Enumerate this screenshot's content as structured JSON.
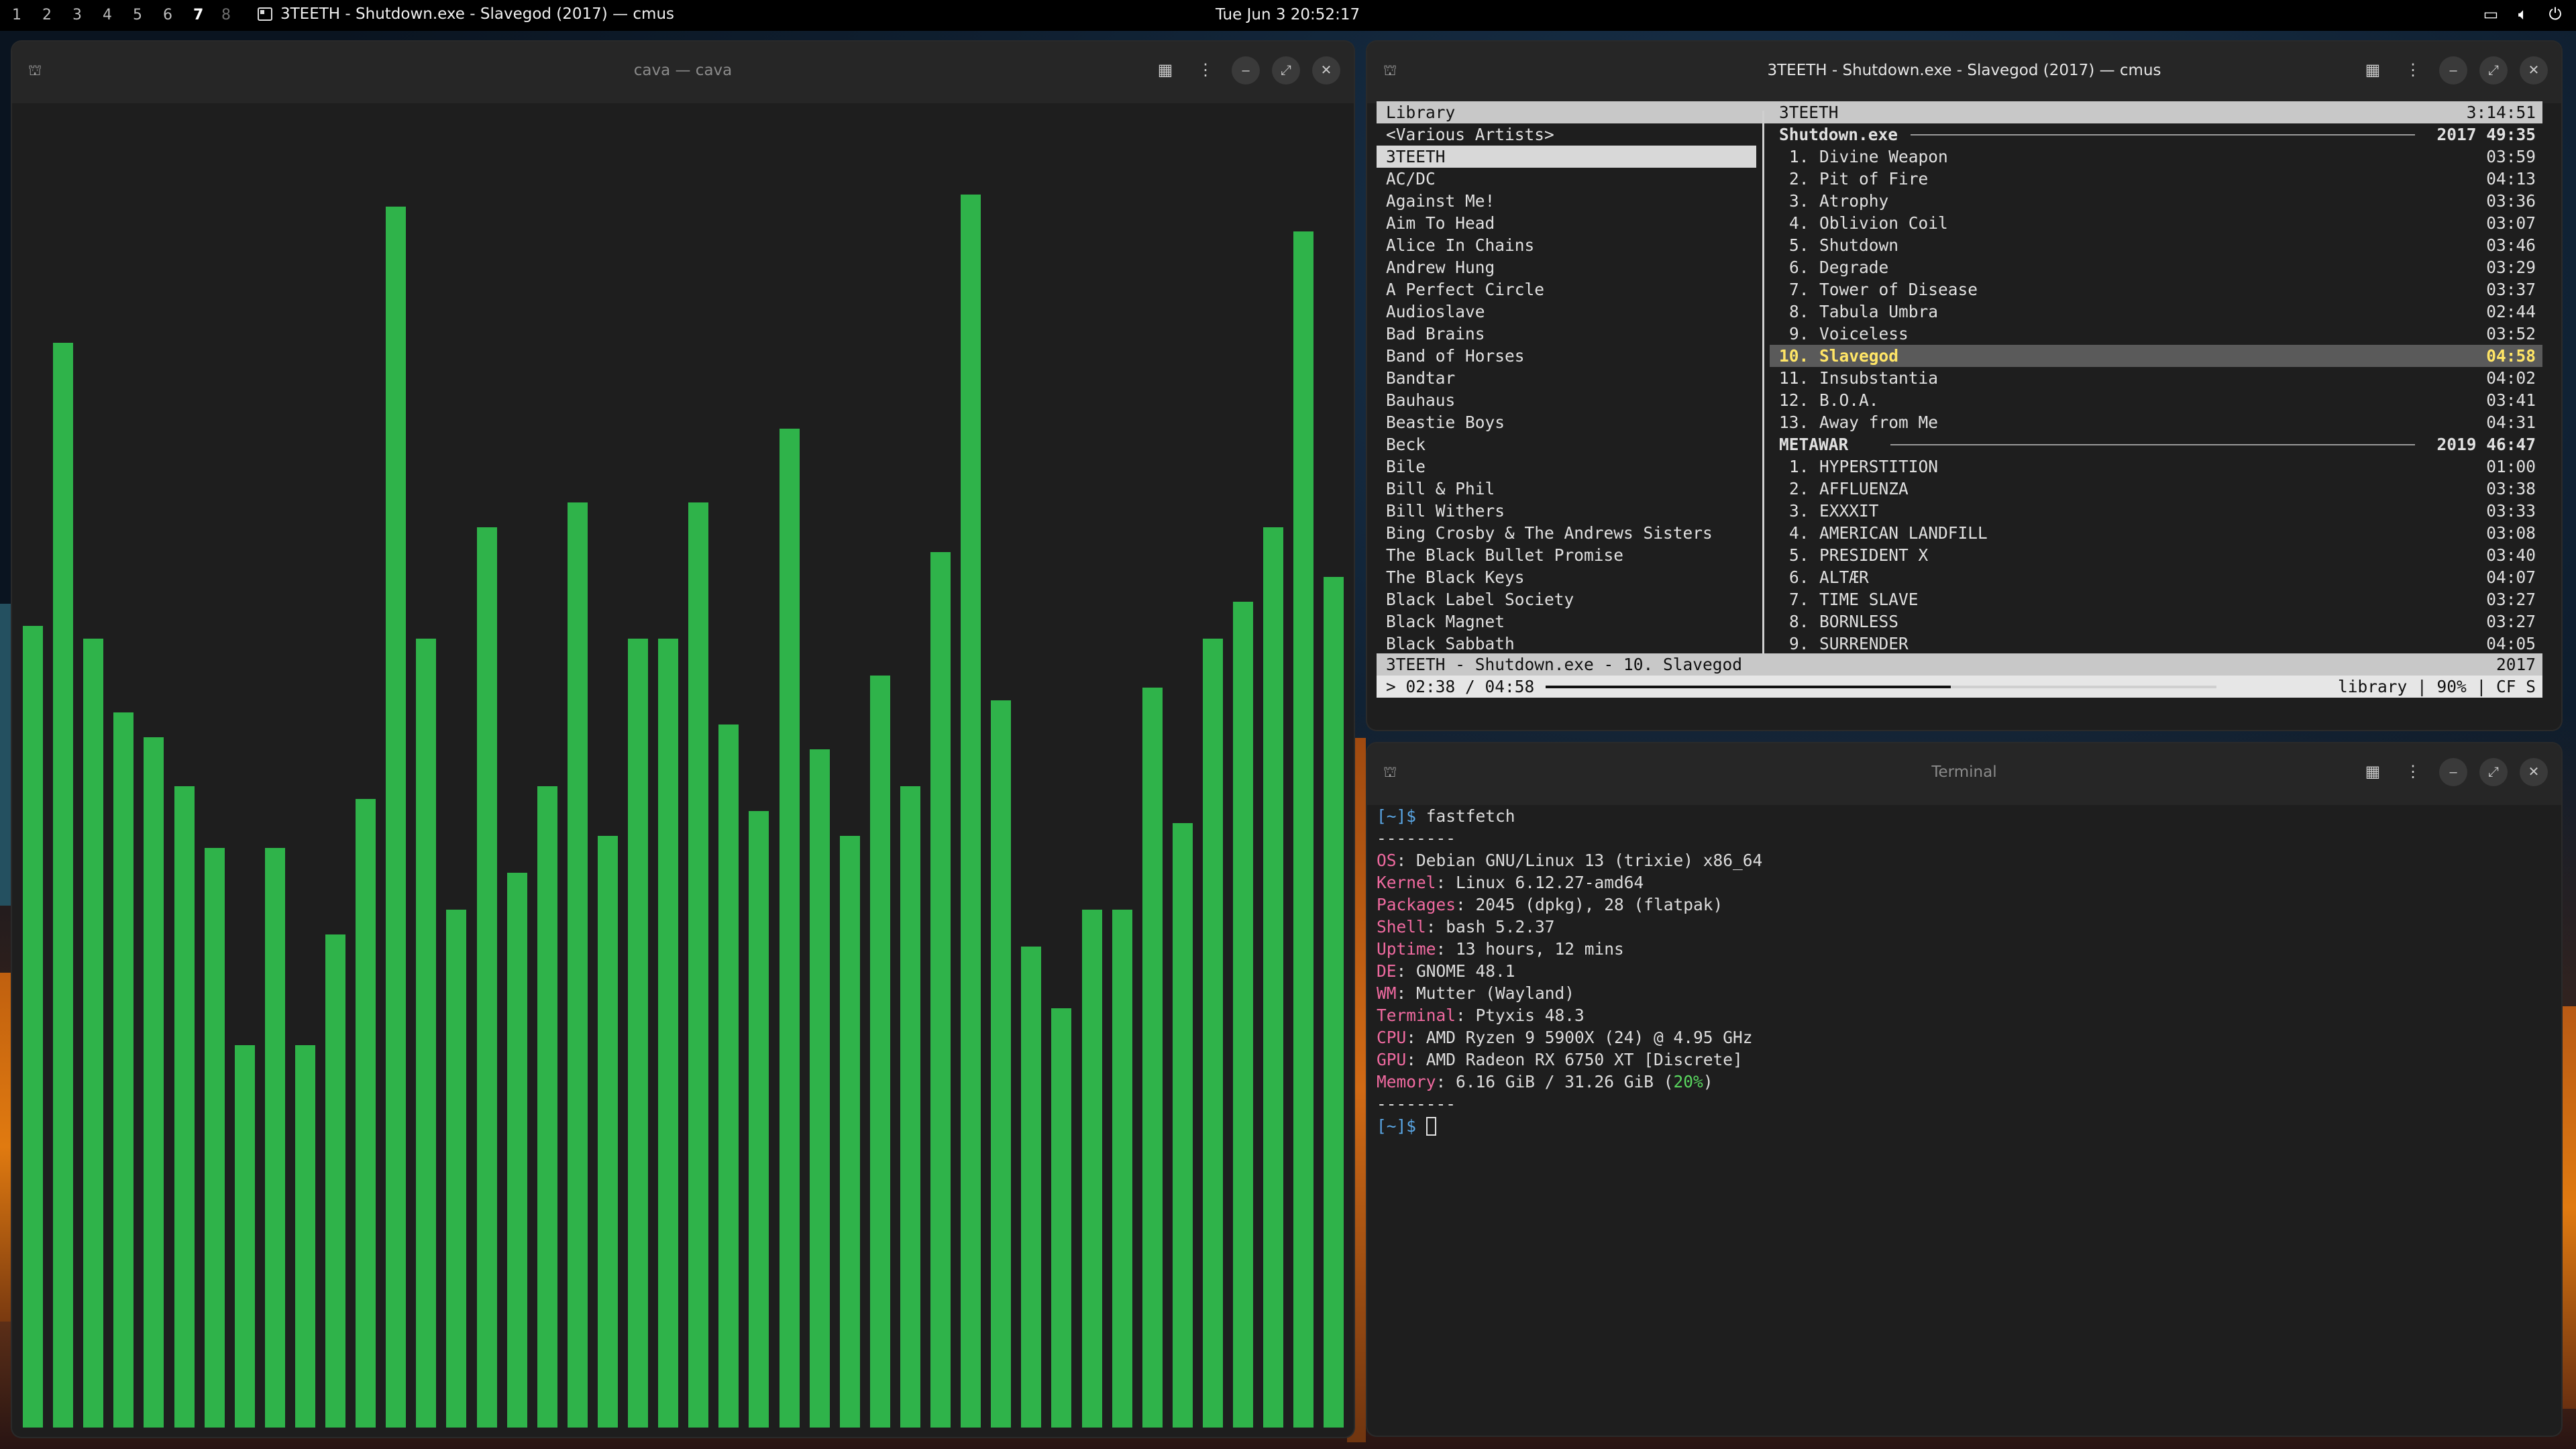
{
  "topbar": {
    "workspaces": [
      {
        "label": "1",
        "state": "normal"
      },
      {
        "label": "2",
        "state": "normal"
      },
      {
        "label": "3",
        "state": "normal"
      },
      {
        "label": "4",
        "state": "normal"
      },
      {
        "label": "5",
        "state": "normal"
      },
      {
        "label": "6",
        "state": "normal"
      },
      {
        "label": "7",
        "state": "active"
      },
      {
        "label": "8",
        "state": "dim"
      }
    ],
    "focused_app_title": "3TEETH - Shutdown.exe - Slavegod (2017) — cmus",
    "clock": "Tue Jun 3  20:52:17",
    "tray_icons": [
      "window-icon",
      "volume-icon",
      "power-icon"
    ]
  },
  "cava": {
    "title": "cava — cava",
    "bar_color": "#2fb34a",
    "levels": [
      0.65,
      0.88,
      0.64,
      0.58,
      0.56,
      0.52,
      0.47,
      0.31,
      0.47,
      0.31,
      0.4,
      0.51,
      0.99,
      0.64,
      0.42,
      0.73,
      0.45,
      0.52,
      0.75,
      0.48,
      0.64,
      0.64,
      0.75,
      0.57,
      0.5,
      0.81,
      0.55,
      0.48,
      0.61,
      0.52,
      0.71,
      1.0,
      0.59,
      0.39,
      0.34,
      0.42,
      0.42,
      0.6,
      0.49,
      0.64,
      0.67,
      0.73,
      0.97,
      0.69
    ]
  },
  "cmus": {
    "title": "3TEETH - Shutdown.exe - Slavegod (2017) — cmus",
    "library_header": "Library",
    "artist_header": "3TEETH",
    "total_duration": "3:14:51",
    "artists": [
      "<Various Artists>",
      "3TEETH",
      "AC/DC",
      "Against Me!",
      "Aim To Head",
      "Alice In Chains",
      "Andrew Hung",
      "A Perfect Circle",
      "Audioslave",
      "Bad Brains",
      "Band of Horses",
      "Bandtar",
      "Bauhaus",
      "Beastie Boys",
      "Beck",
      "Bile",
      "Bill & Phil",
      "Bill Withers",
      "Bing Crosby & The Andrews Sisters",
      "The Black Bullet Promise",
      "The Black Keys",
      "Black Label Society",
      "Black Magnet",
      "Black Sabbath"
    ],
    "selected_artist_index": 1,
    "albums": [
      {
        "name": "Shutdown.exe",
        "year": "2017",
        "duration": "49:35",
        "tracks": [
          {
            "n": "1.",
            "title": "Divine Weapon",
            "time": "03:59"
          },
          {
            "n": "2.",
            "title": "Pit of Fire",
            "time": "04:13"
          },
          {
            "n": "3.",
            "title": "Atrophy",
            "time": "03:36"
          },
          {
            "n": "4.",
            "title": "Oblivion Coil",
            "time": "03:07"
          },
          {
            "n": "5.",
            "title": "Shutdown",
            "time": "03:46"
          },
          {
            "n": "6.",
            "title": "Degrade",
            "time": "03:29"
          },
          {
            "n": "7.",
            "title": "Tower of Disease",
            "time": "03:37"
          },
          {
            "n": "8.",
            "title": "Tabula Umbra",
            "time": "02:44"
          },
          {
            "n": "9.",
            "title": "Voiceless",
            "time": "03:52"
          },
          {
            "n": "10.",
            "title": "Slavegod",
            "time": "04:58",
            "playing": true
          },
          {
            "n": "11.",
            "title": "Insubstantia",
            "time": "04:02"
          },
          {
            "n": "12.",
            "title": "B.O.A.",
            "time": "03:41"
          },
          {
            "n": "13.",
            "title": "Away from Me",
            "time": "04:31"
          }
        ]
      },
      {
        "name": "METAWAR",
        "year": "2019",
        "duration": "46:47",
        "tracks": [
          {
            "n": "1.",
            "title": "HYPERSTITION",
            "time": "01:00"
          },
          {
            "n": "2.",
            "title": "AFFLUENZA",
            "time": "03:38"
          },
          {
            "n": "3.",
            "title": "EXXXIT",
            "time": "03:33"
          },
          {
            "n": "4.",
            "title": "AMERICAN LANDFILL",
            "time": "03:08"
          },
          {
            "n": "5.",
            "title": "PRESIDENT X",
            "time": "03:40"
          },
          {
            "n": "6.",
            "title": "ALTÆR",
            "time": "04:07"
          },
          {
            "n": "7.",
            "title": "TIME SLAVE",
            "time": "03:27"
          },
          {
            "n": "8.",
            "title": "BORNLESS",
            "time": "03:27"
          },
          {
            "n": "9.",
            "title": "SURRENDER",
            "time": "04:05"
          }
        ]
      }
    ],
    "now_playing": "3TEETH - Shutdown.exe - 10. Slavegod",
    "now_playing_year": "2017",
    "position": "> 02:38 / 04:58",
    "progress": 0.53,
    "status_right": "library | 90% | CF S"
  },
  "terminal": {
    "title": "Terminal",
    "prompt": "[~]$",
    "command": "fastfetch",
    "separator": "--------",
    "info": [
      {
        "key": "OS",
        "value": "Debian GNU/Linux 13 (trixie) x86_64"
      },
      {
        "key": "Kernel",
        "value": "Linux 6.12.27-amd64"
      },
      {
        "key": "Packages",
        "value": "2045 (dpkg), 28 (flatpak)"
      },
      {
        "key": "Shell",
        "value": "bash 5.2.37"
      },
      {
        "key": "Uptime",
        "value": "13 hours, 12 mins"
      },
      {
        "key": "DE",
        "value": "GNOME 48.1"
      },
      {
        "key": "WM",
        "value": "Mutter (Wayland)"
      },
      {
        "key": "Terminal",
        "value": "Ptyxis 48.3"
      },
      {
        "key": "CPU",
        "value": "AMD Ryzen 9 5900X (24) @ 4.95 GHz"
      },
      {
        "key": "GPU",
        "value": "AMD Radeon RX 6750 XT [Discrete]"
      },
      {
        "key": "Memory",
        "value": "6.16 GiB / 31.26 GiB (",
        "extra": "20%",
        "close": ")"
      }
    ]
  }
}
